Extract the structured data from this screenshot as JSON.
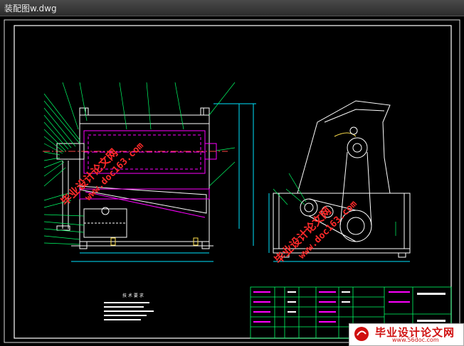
{
  "window": {
    "title": "装配图w.dwg"
  },
  "watermark": {
    "text_cn": "毕业设计论文网",
    "url": "www.doc163.com"
  },
  "tech_requirements": {
    "title": "技 术 要 求"
  },
  "logo": {
    "text": "毕业设计论文网",
    "url": "www.56doc.com"
  },
  "colors": {
    "background": "#000000",
    "frame": "#ffffff",
    "leader": "#00ff66",
    "part": "#ff00ff",
    "watermark": "#ff2a2a"
  }
}
